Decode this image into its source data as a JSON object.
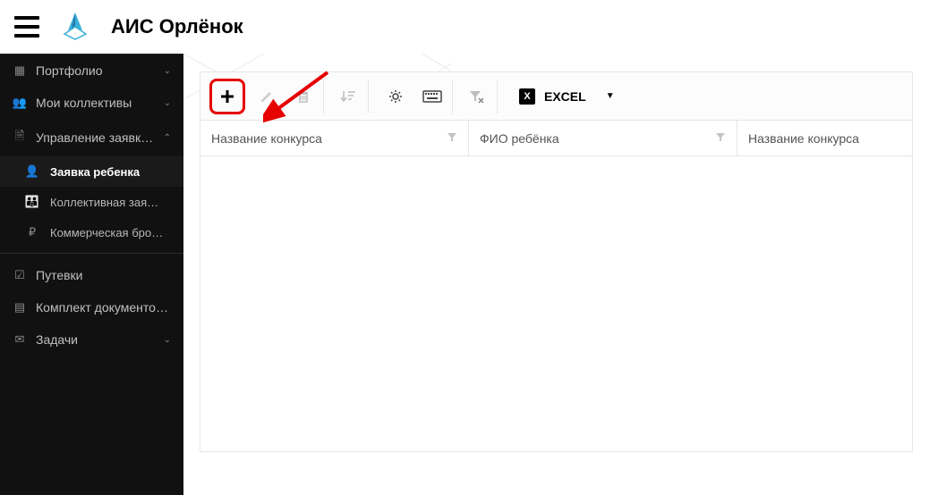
{
  "header": {
    "title": "АИС Орлёнок"
  },
  "sidebar": {
    "items": [
      {
        "icon": "briefcase",
        "label": "Портфолио",
        "expand": "down"
      },
      {
        "icon": "users",
        "label": "Мои коллективы",
        "expand": "down"
      },
      {
        "icon": "doc",
        "label": "Управление заявк…",
        "expand": "up"
      }
    ],
    "subitems": [
      {
        "icon": "person",
        "label": "Заявка ребенка",
        "active": true
      },
      {
        "icon": "group",
        "label": "Коллективная зая…"
      },
      {
        "icon": "ruble",
        "label": "Коммерческая бро…"
      }
    ],
    "items2": [
      {
        "icon": "check",
        "label": "Путевки"
      },
      {
        "icon": "list",
        "label": "Комплект документо…"
      },
      {
        "icon": "mail",
        "label": "Задачи",
        "expand": "down"
      }
    ]
  },
  "toolbar": {
    "excel_label": "EXCEL",
    "excel_badge": "X"
  },
  "table": {
    "columns": [
      "Название конкурса",
      "ФИО ребёнка",
      "Название конкурса"
    ]
  }
}
